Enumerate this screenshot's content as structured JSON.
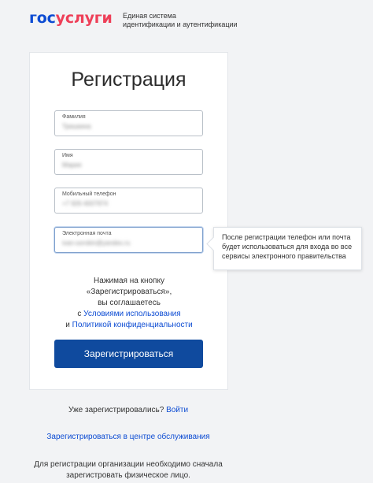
{
  "header": {
    "logo_part1": "гос",
    "logo_part2": "услуги",
    "tagline_line1": "Единая система",
    "tagline_line2": "идентификации и аутентификации"
  },
  "form": {
    "title": "Регистрация",
    "fields": [
      {
        "label": "Фамилия",
        "value": "Тришкина"
      },
      {
        "label": "Имя",
        "value": "Мария"
      },
      {
        "label": "Мобильный телефон",
        "value": "+7 926 4007974"
      },
      {
        "label": "Электронная почта",
        "value": "ivan-sorokin@yandex.ru"
      }
    ],
    "agreement": {
      "line1": "Нажимая на кнопку",
      "line2": "«Зарегистрироваться»,",
      "line3": "вы соглашаетесь",
      "line4_prefix": "с ",
      "terms_link": "Условиями использования",
      "line5_prefix": "и ",
      "privacy_link": "Политикой конфиденциальности"
    },
    "submit_label": "Зарегистрироваться"
  },
  "tooltip": {
    "line1": "После регистрации телефон или почта",
    "line2": "будет использоваться для входа во все",
    "line3": "сервисы электронного правительства"
  },
  "footer": {
    "already_text": "Уже зарегистрировались? ",
    "login_link": "Войти",
    "service_center_link": "Зарегистрироваться в центре обслуживания",
    "org_line1": "Для регистрации организации необходимо сначала",
    "org_line2": "зарегистровать физическое лицо."
  },
  "colors": {
    "brand_blue": "#0d4cd3",
    "brand_red": "#ee3f58",
    "button": "#0f4a9e"
  }
}
